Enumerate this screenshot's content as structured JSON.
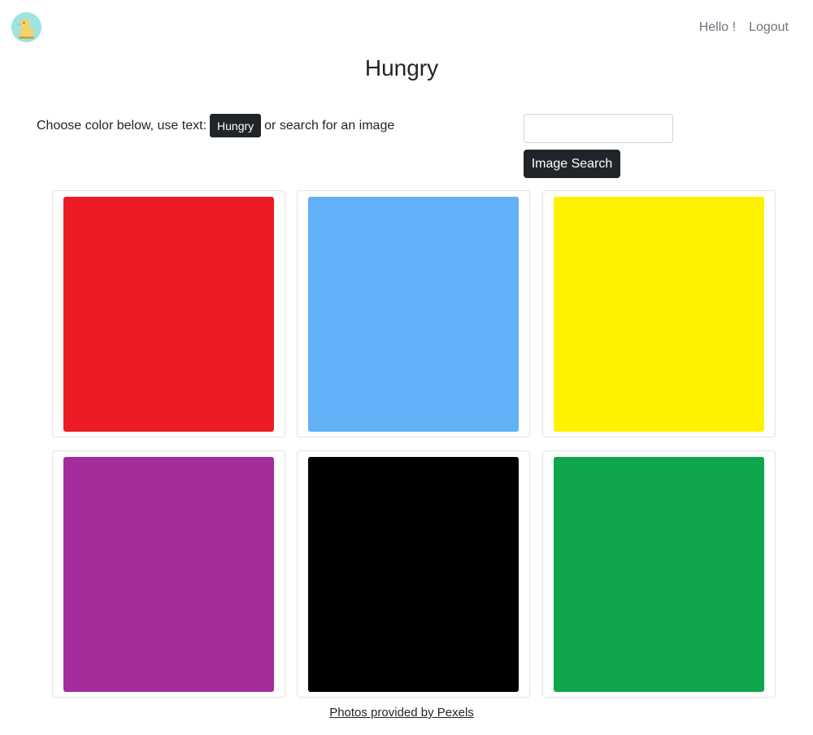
{
  "nav": {
    "logo_icon": "duck-logo-icon",
    "greeting": "Hello !",
    "logout": "Logout"
  },
  "page": {
    "title": "Hungry"
  },
  "instructions": {
    "prefix": "Choose color below, use text:",
    "chip": "Hungry",
    "suffix": "or search for an image"
  },
  "search": {
    "value": "",
    "placeholder": "",
    "button": "Image Search"
  },
  "colors": [
    {
      "name": "red",
      "hex": "#ed1c24"
    },
    {
      "name": "blue",
      "hex": "#62b0f6"
    },
    {
      "name": "yellow",
      "hex": "#fff200"
    },
    {
      "name": "purple",
      "hex": "#a32d9a"
    },
    {
      "name": "black",
      "hex": "#000000"
    },
    {
      "name": "green",
      "hex": "#0ea74e"
    }
  ],
  "footer": {
    "credit": "Photos provided by Pexels"
  }
}
